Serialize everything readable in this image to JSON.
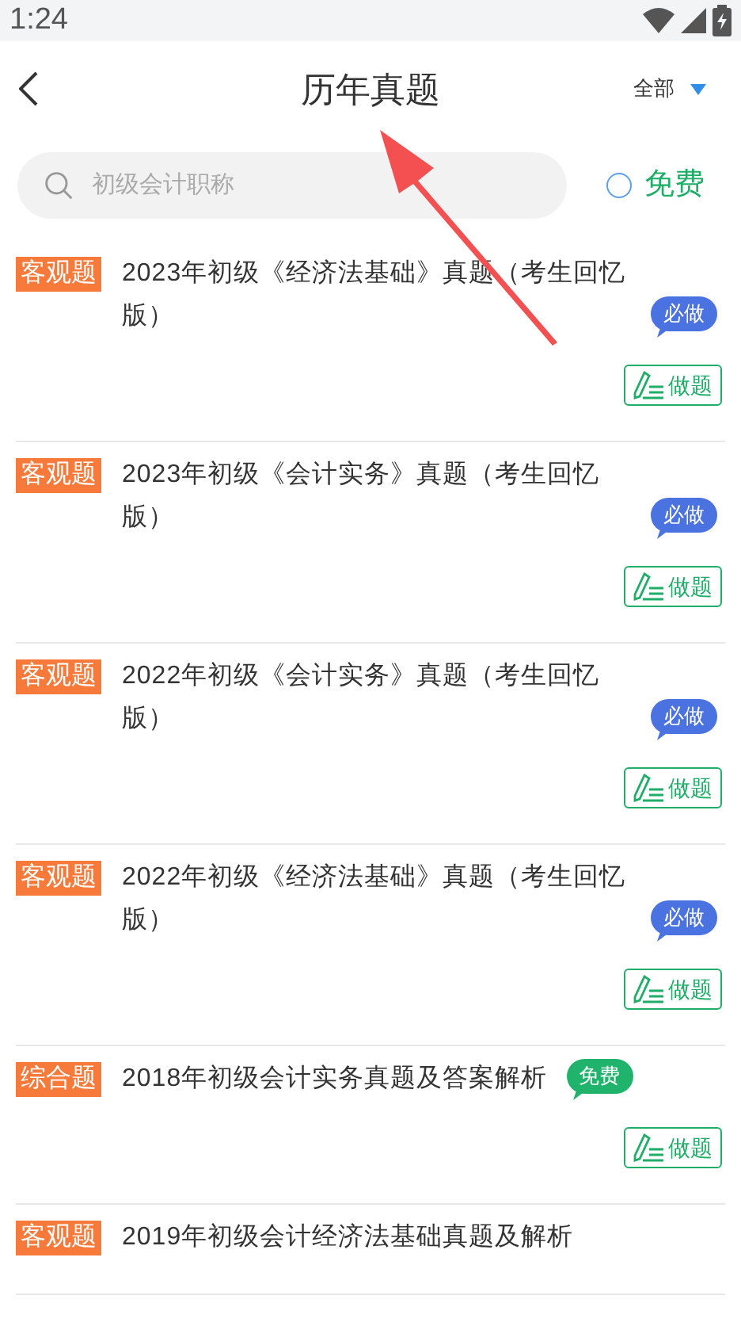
{
  "status_bar": {
    "time": "1:24"
  },
  "header": {
    "title": "历年真题",
    "filter": "全部"
  },
  "search": {
    "placeholder": "初级会计职称"
  },
  "free_filter": {
    "label": "免费",
    "checked": false
  },
  "items": [
    {
      "tag": "客观题",
      "title": "2023年初级《经济法基础》真题（考生回忆版）",
      "badge": {
        "kind": "must",
        "label": "必做"
      },
      "action": "做题"
    },
    {
      "tag": "客观题",
      "title": "2023年初级《会计实务》真题（考生回忆版）",
      "badge": {
        "kind": "must",
        "label": "必做"
      },
      "action": "做题"
    },
    {
      "tag": "客观题",
      "title": "2022年初级《会计实务》真题（考生回忆版）",
      "badge": {
        "kind": "must",
        "label": "必做"
      },
      "action": "做题"
    },
    {
      "tag": "客观题",
      "title": "2022年初级《经济法基础》真题（考生回忆版）",
      "badge": {
        "kind": "must",
        "label": "必做"
      },
      "action": "做题"
    },
    {
      "tag": "综合题",
      "title": "2018年初级会计实务真题及答案解析",
      "badge": {
        "kind": "free",
        "label": "免费"
      },
      "action": "做题"
    },
    {
      "tag": "客观题",
      "title": "2019年初级会计经济法基础真题及解析"
    }
  ]
}
